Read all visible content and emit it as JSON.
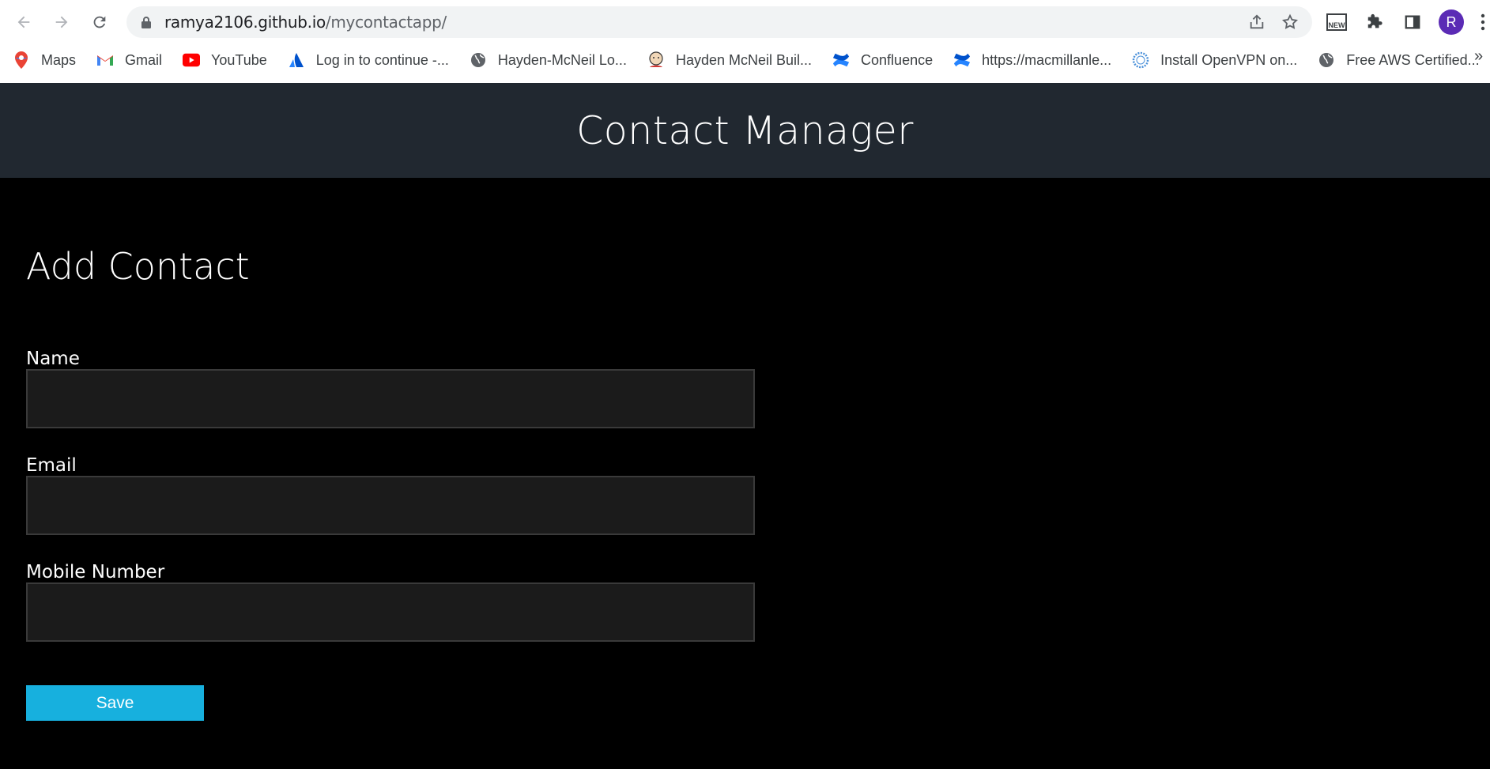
{
  "browser": {
    "url_domain": "ramya2106.github.io",
    "url_path": "/mycontactapp/",
    "avatar_letter": "R",
    "ext_badge": "NEW",
    "bookmarks": [
      {
        "label": "Maps",
        "icon": "maps-icon"
      },
      {
        "label": "Gmail",
        "icon": "gmail-icon"
      },
      {
        "label": "YouTube",
        "icon": "youtube-icon"
      },
      {
        "label": "Log in to continue -...",
        "icon": "atlassian-icon"
      },
      {
        "label": "Hayden-McNeil Lo...",
        "icon": "globe-icon"
      },
      {
        "label": "Hayden McNeil Buil...",
        "icon": "jenkins-icon"
      },
      {
        "label": "Confluence",
        "icon": "confluence-icon"
      },
      {
        "label": "https://macmillanle...",
        "icon": "confluence-icon"
      },
      {
        "label": "Install OpenVPN on...",
        "icon": "openvpn-icon"
      },
      {
        "label": "Free AWS Certified...",
        "icon": "globe-icon"
      }
    ],
    "more_bookmarks": "»"
  },
  "app": {
    "title": "Contact Manager"
  },
  "form": {
    "heading": "Add Contact",
    "name_label": "Name",
    "name_value": "",
    "email_label": "Email",
    "email_value": "",
    "mobile_label": "Mobile Number",
    "mobile_value": "",
    "save_label": "Save"
  },
  "colors": {
    "header_bg": "#212830",
    "page_bg": "#000000",
    "input_bg": "#1b1b1b",
    "button_bg": "#17b0de"
  }
}
